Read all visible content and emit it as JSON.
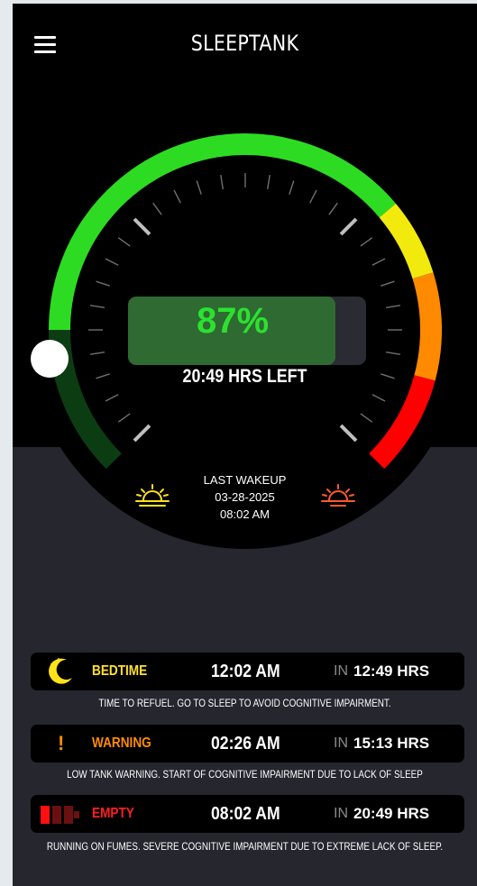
{
  "app": {
    "title": "SLEEPTANK"
  },
  "gauge": {
    "fill_percent": 87,
    "percent_label": "87%",
    "hours_left": "20:49 HRS LEFT",
    "zone_colors": {
      "green": "#2ddc22",
      "dark_green": "#0c3d12",
      "yellow": "#f2ea0c",
      "orange": "#ff8a00",
      "red": "#ff0000"
    }
  },
  "last_wakeup": {
    "label": "LAST WAKEUP",
    "date": "03-28-2025",
    "time": "08:02 AM"
  },
  "schedule": [
    {
      "icon": "moon-stars-icon",
      "label": "BEDTIME",
      "label_color": "#ffe030",
      "time": "12:02 AM",
      "in": "IN",
      "hrs": "12:49 HRS",
      "desc": "TIME TO REFUEL. GO TO SLEEP TO AVOID COGNITIVE IMPAIRMENT."
    },
    {
      "icon": "exclamation-icon",
      "label": "WARNING",
      "label_color": "#ff8c00",
      "time": "02:26 AM",
      "in": "IN",
      "hrs": "15:13 HRS",
      "desc": "LOW TANK WARNING. START OF COGNITIVE IMPAIRMENT DUE TO LACK OF SLEEP"
    },
    {
      "icon": "empty-battery-icon",
      "label": "EMPTY",
      "label_color": "#ff2020",
      "time": "08:02 AM",
      "in": "IN",
      "hrs": "20:49 HRS",
      "desc": "RUNNING ON FUMES. SEVERE COGNITIVE IMPAIRMENT DUE TO EXTREME LACK OF SLEEP."
    }
  ]
}
